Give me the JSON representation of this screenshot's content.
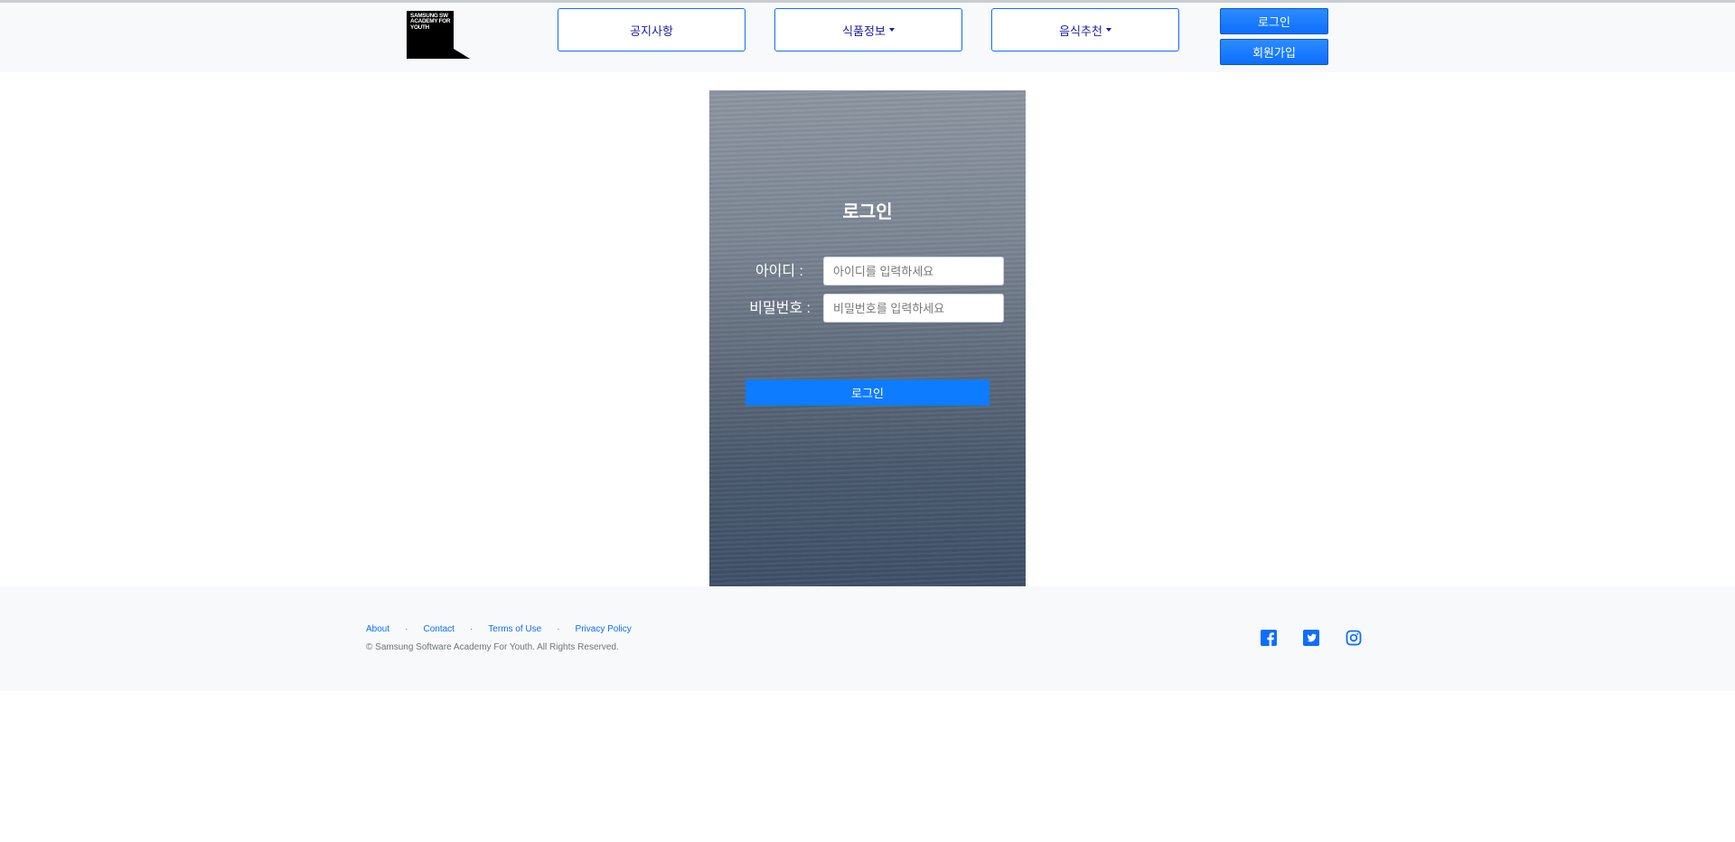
{
  "header": {
    "logo_text": "SAMSUNG SW ACADEMY FOR YOUTH",
    "nav": [
      {
        "label": "공지사항",
        "dropdown": false
      },
      {
        "label": "식품정보",
        "dropdown": true
      },
      {
        "label": "음식추천",
        "dropdown": true
      }
    ],
    "login_label": "로그인",
    "signup_label": "회원가입"
  },
  "login": {
    "title": "로그인",
    "id_label": "아이디 :",
    "id_placeholder": "아이디를 입력하세요",
    "pw_label": "비밀번호 :",
    "pw_placeholder": "비밀번호를 입력하세요",
    "submit_label": "로그인"
  },
  "footer": {
    "links": [
      "About",
      "Contact",
      "Terms of Use",
      "Privacy Policy"
    ],
    "separator": "·",
    "copyright": "© Samsung Software Academy For Youth. All Rights Reserved.",
    "social_icons": [
      "facebook-icon",
      "twitter-icon",
      "instagram-icon"
    ]
  },
  "colors": {
    "accent": "#0d6efd",
    "header_bg": "#f8f9fa",
    "nav_text": "#1a1aa8"
  }
}
